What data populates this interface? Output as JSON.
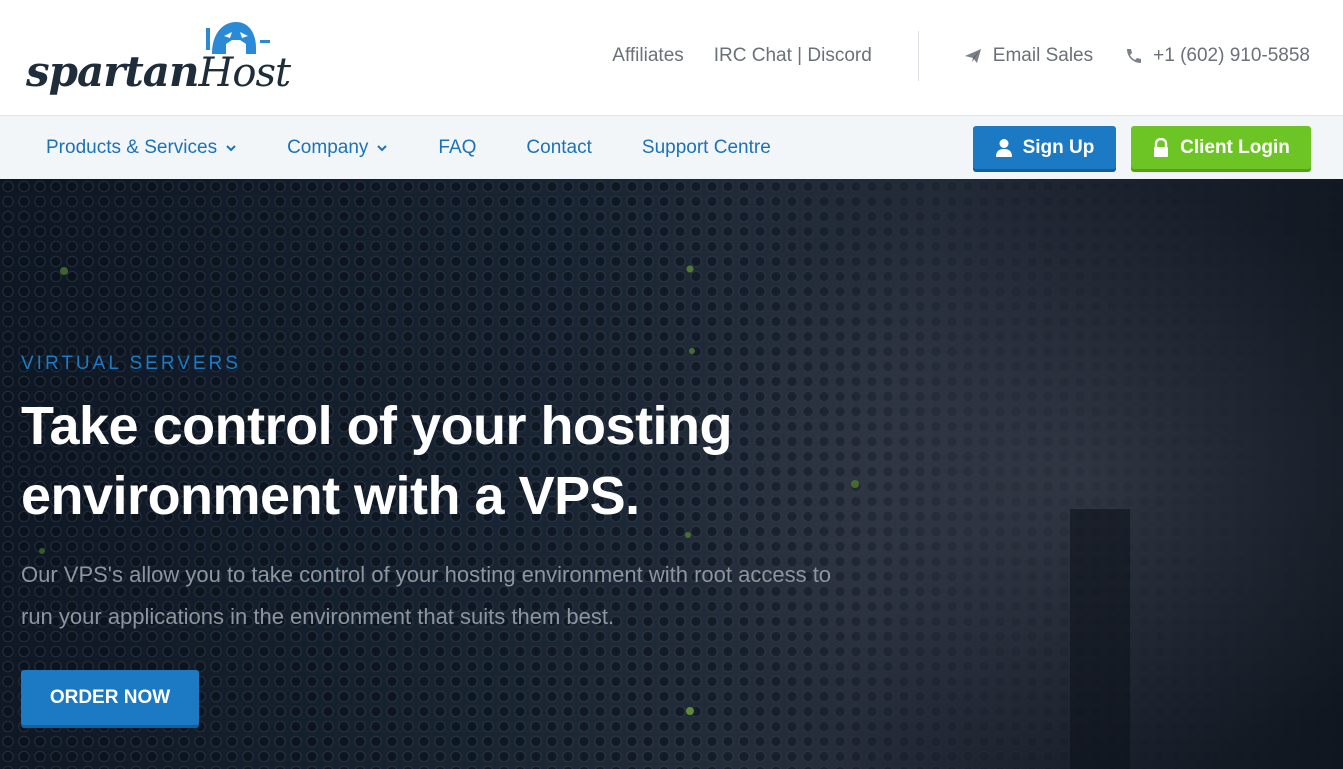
{
  "brand": {
    "logo_word_1": "spartan",
    "logo_word_2": "Host",
    "logo_icon": "spartan-helmet-icon",
    "logo_color": "#1f2d3a",
    "helmet_color": "#2b8ad6"
  },
  "top_links": {
    "affiliates": "Affiliates",
    "irc_discord": "IRC Chat | Discord",
    "email_sales": "Email Sales",
    "email_icon": "paper-plane-icon",
    "phone": "+1 (602) 910-5858",
    "phone_icon": "phone-icon"
  },
  "nav": {
    "items": [
      {
        "label": "Products & Services",
        "dropdown": true
      },
      {
        "label": "Company",
        "dropdown": true
      },
      {
        "label": "FAQ",
        "dropdown": false
      },
      {
        "label": "Contact",
        "dropdown": false
      },
      {
        "label": "Support Centre",
        "dropdown": false
      }
    ],
    "signup_label": "Sign Up",
    "signup_icon": "user-icon",
    "login_label": "Client Login",
    "login_icon": "lock-icon"
  },
  "hero": {
    "eyebrow": "VIRTUAL SERVERS",
    "headline": "Take control of your hosting environment with a VPS.",
    "subtext": "Our VPS's allow you to take control of your hosting environment with root access to run your applications in the environment that suits them best.",
    "cta_label": "ORDER NOW"
  },
  "colors": {
    "accent_blue": "#1c7ac4",
    "accent_green": "#6cc524",
    "nav_text": "#1c72b8",
    "muted_text": "#6b7178"
  }
}
